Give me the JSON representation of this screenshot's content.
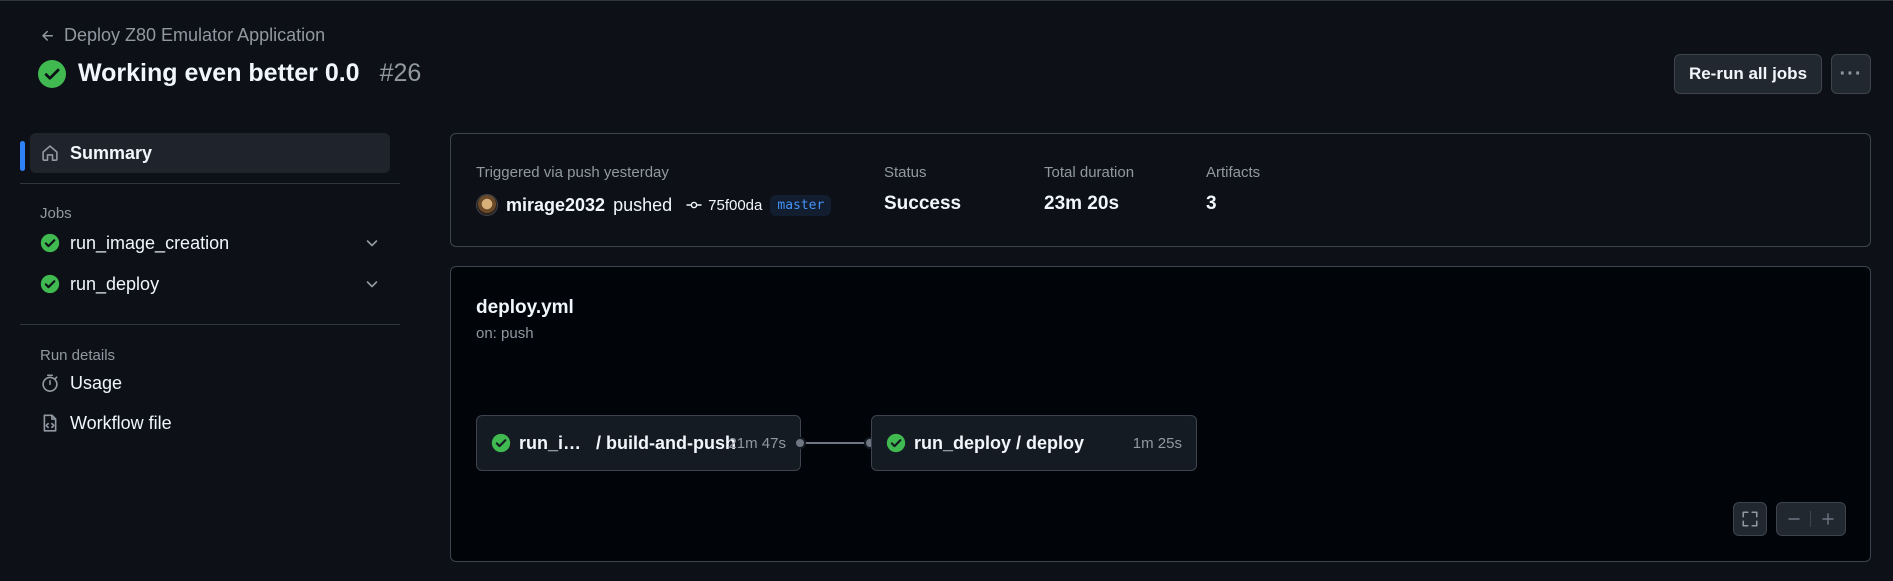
{
  "header": {
    "back_label": "Deploy Z80 Emulator Application",
    "title": "Working even better 0.0",
    "run_number": "#26",
    "rerun_label": "Re-run all jobs",
    "more_label": "···"
  },
  "sidebar": {
    "summary_label": "Summary",
    "jobs_heading": "Jobs",
    "jobs": [
      {
        "label": "run_image_creation"
      },
      {
        "label": "run_deploy"
      }
    ],
    "run_details_heading": "Run details",
    "details": [
      {
        "label": "Usage"
      },
      {
        "label": "Workflow file"
      }
    ]
  },
  "summary": {
    "trigger_label": "Triggered via push yesterday",
    "actor": "mirage2032",
    "action": "pushed",
    "commit": "75f00da",
    "branch": "master",
    "status_label": "Status",
    "status_value": "Success",
    "duration_label": "Total duration",
    "duration_value": "23m 20s",
    "artifacts_label": "Artifacts",
    "artifacts_value": "3"
  },
  "workflow": {
    "file": "deploy.yml",
    "trigger": "on: push",
    "jobs": [
      {
        "name": "run_i…   / build-and-push",
        "duration": "21m 47s"
      },
      {
        "name": "run_deploy / deploy",
        "duration": "1m 25s"
      }
    ]
  },
  "colors": {
    "background": "#0d1117",
    "success": "#3fb950",
    "accent": "#2f81f7",
    "border": "#3d444d"
  }
}
